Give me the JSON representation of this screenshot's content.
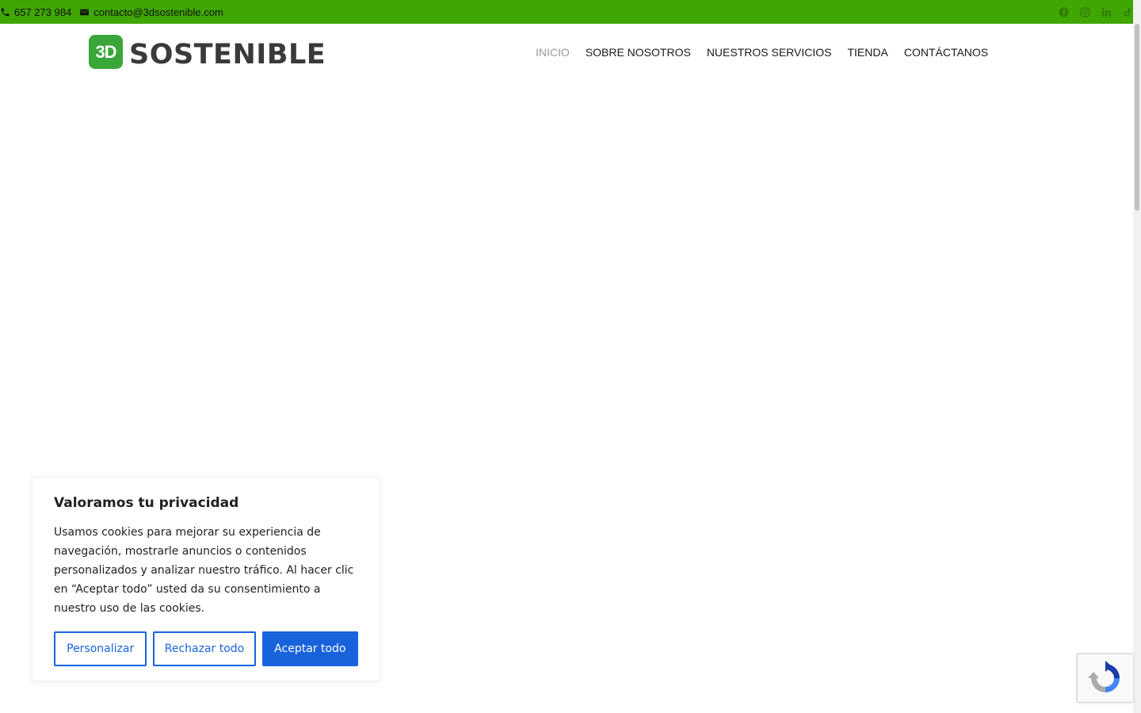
{
  "topbar": {
    "phone": "657 273 984",
    "email": "contacto@3dsostenible.com",
    "background": "#3fa603",
    "social": [
      "facebook-icon",
      "instagram-icon",
      "linkedin-icon",
      "tiktok-icon"
    ]
  },
  "header": {
    "logo_badge": "3D",
    "logo_text": "SOSTENIBLE",
    "nav": [
      "INICIO",
      "SOBRE NOSOTROS",
      "NUESTROS SERVICIOS",
      "TIENDA",
      "CONTÁCTANOS"
    ],
    "active_index": 0
  },
  "cookie_banner": {
    "title": "Valoramos tu privacidad",
    "body": "Usamos cookies para mejorar su experiencia de navegación, mostrarle anuncios o contenidos personalizados y analizar nuestro tráfico. Al hacer clic en “Aceptar todo” usted da su consentimiento a nuestro uso de las cookies.",
    "customize_label": "Personalizar",
    "reject_label": "Rechazar todo",
    "accept_label": "Aceptar todo",
    "accent": "#1863dc"
  }
}
